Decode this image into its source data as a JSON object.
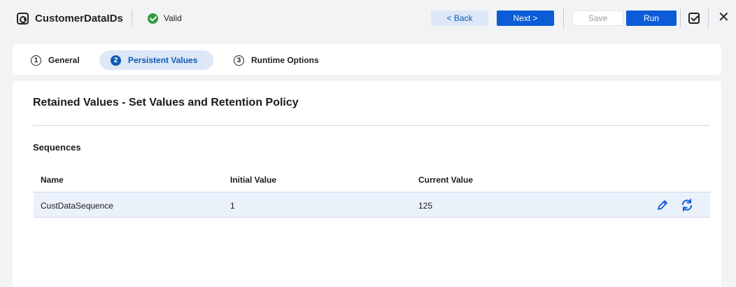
{
  "header": {
    "app_title": "CustomerDataIDs",
    "status_label": "Valid",
    "back_label": "< Back",
    "next_label": "Next >",
    "save_label": "Save",
    "run_label": "Run",
    "close_label": "✕"
  },
  "tabs": [
    {
      "number": "1",
      "label": "General",
      "active": false
    },
    {
      "number": "2",
      "label": "Persistent Values",
      "active": true
    },
    {
      "number": "3",
      "label": "Runtime Options",
      "active": false
    }
  ],
  "panel": {
    "title": "Retained Values - Set Values and Retention Policy",
    "section_title": "Sequences"
  },
  "table": {
    "columns": [
      "Name",
      "Initial Value",
      "Current Value"
    ],
    "rows": [
      {
        "name": "CustDataSequence",
        "initial_value": "1",
        "current_value": "125"
      }
    ]
  },
  "colors": {
    "accent": "#0b5cd6",
    "valid": "#2e9c39",
    "row_highlight": "#ebf1fb"
  }
}
